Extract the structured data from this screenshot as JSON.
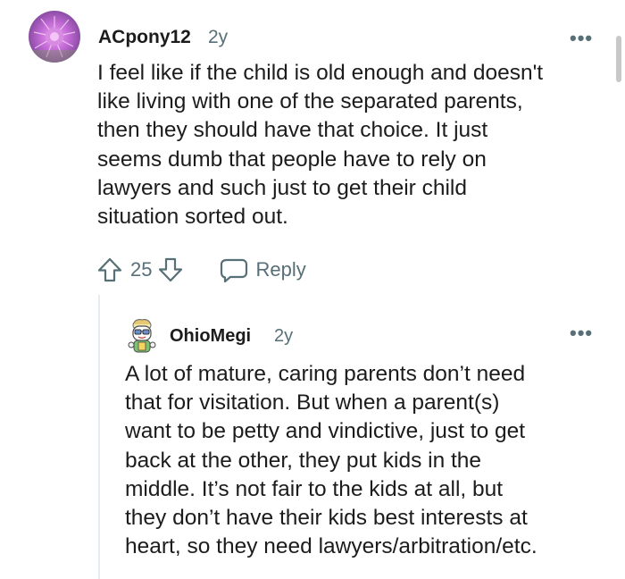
{
  "comment": {
    "username": "ACpony12",
    "age": "2y",
    "more_label": "•••",
    "lines": [
      "I feel like if the child is old enough and doesn't",
      "like living with one of the separated parents,",
      "then they should have that choice. It just",
      "seems dumb that people have to rely on",
      "lawyers and such just to get their child",
      "situation sorted out."
    ],
    "vote_count": "25",
    "reply_label": "Reply"
  },
  "reply": {
    "username": "OhioMegi",
    "age": "2y",
    "more_label": "•••",
    "lines": [
      "A lot of mature, caring parents don’t need",
      "that for visitation. But when a parent(s)",
      "want to be petty and vindictive, just to get",
      "back at the other, they put kids in the",
      "middle. It’s not fair to the kids at all, but",
      "they don’t have their kids best interests at",
      "heart, so they need lawyers/arbitration/etc."
    ]
  },
  "colors": {
    "text": "#1c1c1c",
    "meta": "#576f76",
    "thread_line": "#e5ebee"
  }
}
